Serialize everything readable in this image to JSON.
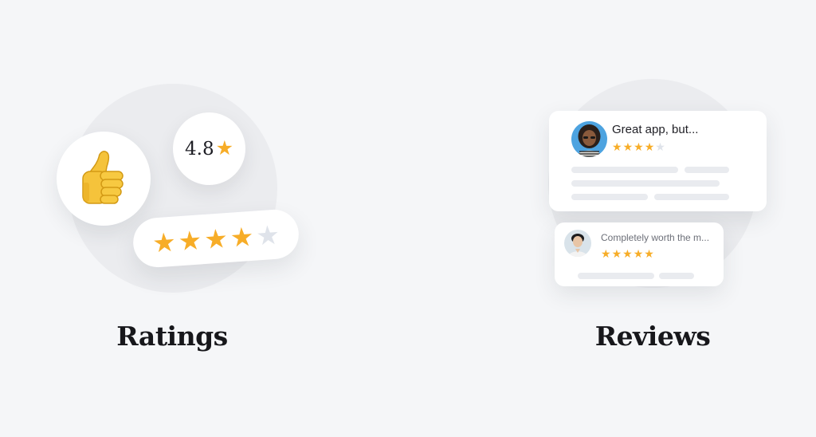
{
  "colors": {
    "background": "#f5f6f8",
    "circle": "#ebecef",
    "star_filled": "#f7ad28",
    "star_empty": "#dfe3ea"
  },
  "ratings": {
    "caption": "Ratings",
    "thumb_icon": "thumbs-up-icon",
    "score": "4.8",
    "score_star": "★",
    "stars": {
      "filled": 4,
      "total": 5
    },
    "star_glyphs": [
      "★",
      "★",
      "★",
      "★",
      "★"
    ]
  },
  "reviews": {
    "caption": "Reviews",
    "items": [
      {
        "title": "Great app, but...",
        "rating": 4,
        "star_glyphs": [
          "★",
          "★",
          "★",
          "★",
          "★"
        ]
      },
      {
        "title": "Completely worth the m...",
        "rating": 5,
        "star_glyphs": [
          "★",
          "★",
          "★",
          "★",
          "★"
        ]
      }
    ]
  }
}
